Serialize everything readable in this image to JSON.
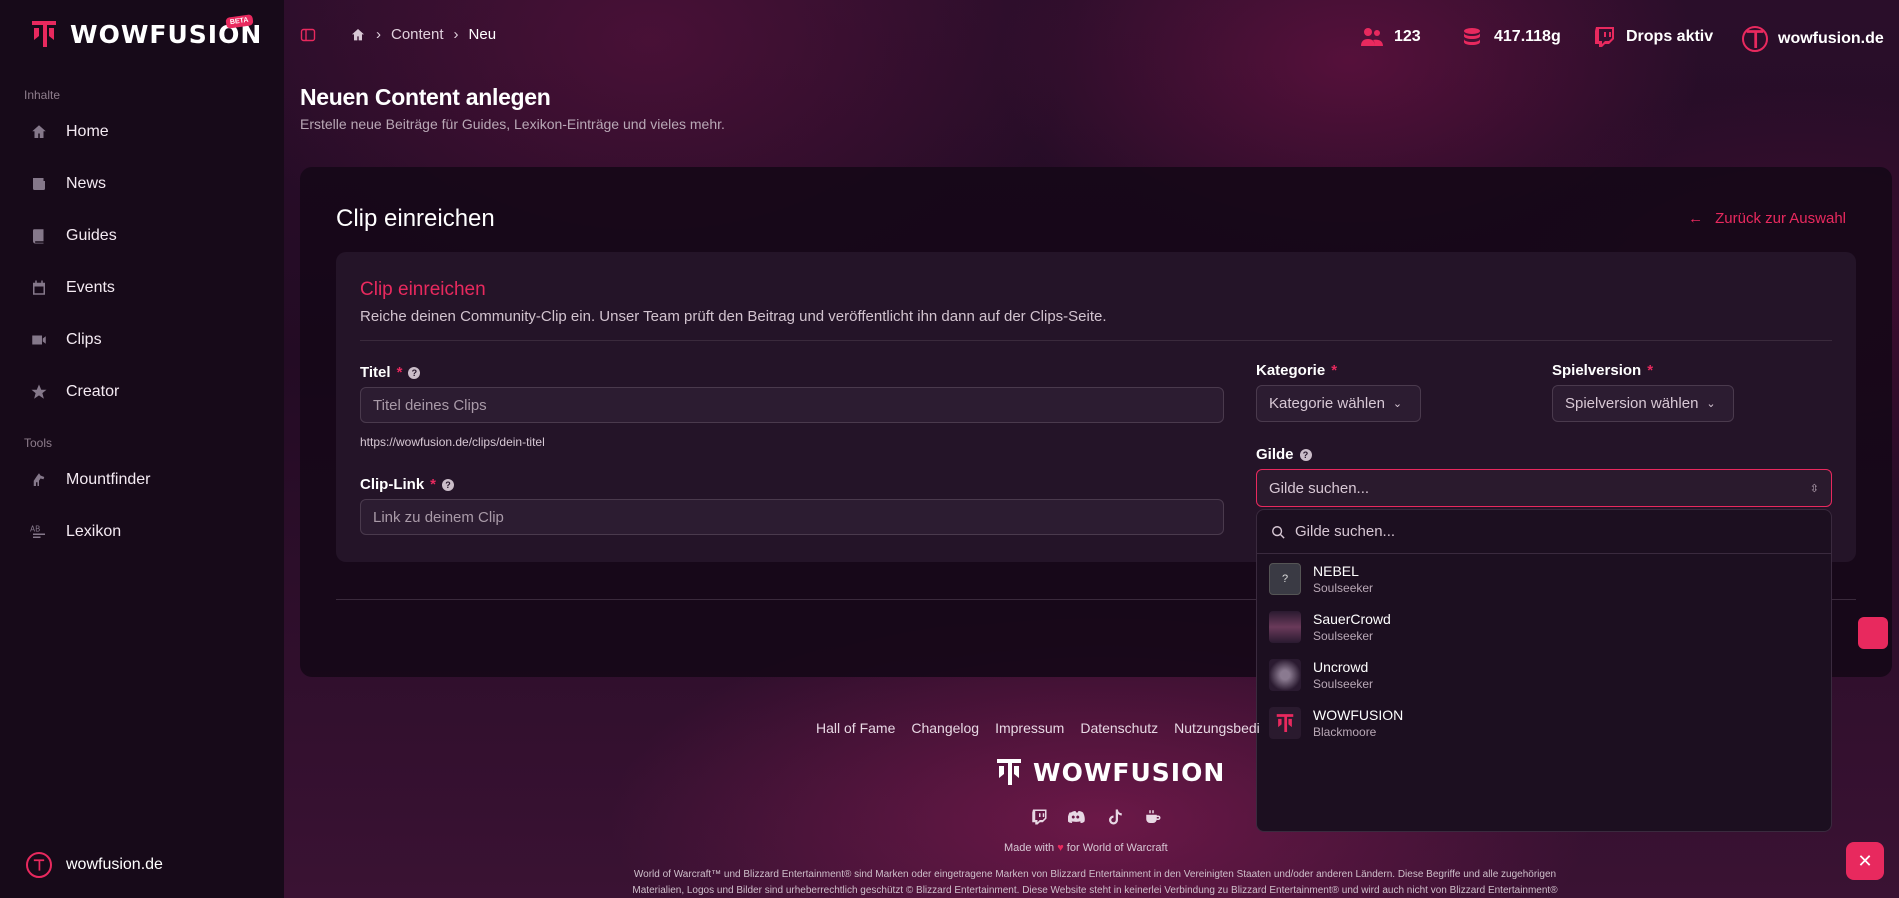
{
  "brand": {
    "name": "WOWFUSION",
    "badge": "BETA",
    "accent": "#e8295e"
  },
  "sidebar": {
    "section_content": "Inhalte",
    "items": [
      {
        "label": "Home",
        "icon": "home-icon"
      },
      {
        "label": "News",
        "icon": "newspaper-icon"
      },
      {
        "label": "Guides",
        "icon": "book-icon"
      },
      {
        "label": "Events",
        "icon": "calendar-icon"
      },
      {
        "label": "Clips",
        "icon": "video-icon"
      },
      {
        "label": "Creator",
        "icon": "star-icon"
      }
    ],
    "section_tools": "Tools",
    "tools": [
      {
        "label": "Mountfinder",
        "icon": "horse-icon"
      },
      {
        "label": "Lexikon",
        "icon": "abc-icon"
      }
    ],
    "footer_label": "wowfusion.de"
  },
  "breadcrumb": {
    "items": [
      "Content",
      "Neu"
    ]
  },
  "topbar": {
    "members": "123",
    "gold": "417.118g",
    "drops": "Drops aktiv",
    "site": "wowfusion.de"
  },
  "page": {
    "title": "Neuen Content anlegen",
    "subtitle": "Erstelle neue Beiträge für Guides, Lexikon-Einträge und vieles mehr."
  },
  "card": {
    "title": "Clip einreichen",
    "back_label": "Zurück zur Auswahl",
    "form_title": "Clip einreichen",
    "form_desc": "Reiche deinen Community-Clip ein. Unser Team prüft den Beitrag und veröffentlicht ihn dann auf der Clips-Seite.",
    "title_label": "Titel",
    "title_placeholder": "Titel deines Clips",
    "slug_hint": "https://wowfusion.de/clips/dein-titel",
    "link_label": "Clip-Link",
    "link_placeholder": "Link zu deinem Clip",
    "category_label": "Kategorie",
    "category_value": "Kategorie wählen",
    "version_label": "Spielversion",
    "version_value": "Spielversion wählen",
    "guild_label": "Gilde",
    "guild_placeholder": "Gilde suchen...",
    "required_mark": "*"
  },
  "guild_dropdown": {
    "search_placeholder": "Gilde suchen...",
    "items": [
      {
        "name": "NEBEL",
        "realm": "Soulseeker",
        "thumb": "?"
      },
      {
        "name": "SauerCrowd",
        "realm": "Soulseeker",
        "thumb": ""
      },
      {
        "name": "Uncrowd",
        "realm": "Soulseeker",
        "thumb": ""
      },
      {
        "name": "WOWFUSION",
        "realm": "Blackmoore",
        "thumb": ""
      }
    ]
  },
  "footer": {
    "links": [
      "Hall of Fame",
      "Changelog",
      "Impressum",
      "Datenschutz",
      "Nutzungsbedi"
    ],
    "logo_text": "WOWFUSION",
    "made_with_prefix": "Made with",
    "made_with_suffix": "for World of Warcraft",
    "legal_1": "World of Warcraft™ und Blizzard Entertainment® sind Marken oder eingetragene Marken von Blizzard Entertainment in den Vereinigten Staaten und/oder anderen Ländern. Diese Begriffe und alle zugehörigen",
    "legal_2": "Materialien, Logos und Bilder sind urheberrechtlich geschützt © Blizzard Entertainment. Diese Website steht in keinerlei Verbindung zu Blizzard Entertainment® und wird auch nicht von Blizzard Entertainment®"
  }
}
